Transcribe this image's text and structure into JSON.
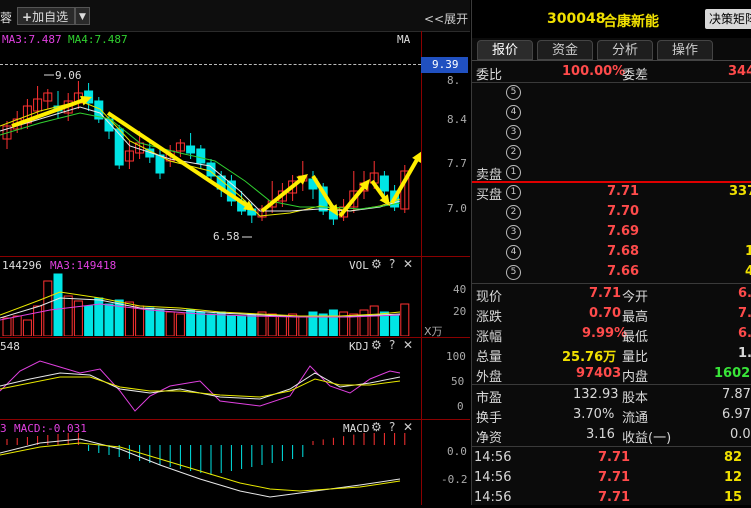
{
  "toolbar": {
    "name_fragment": "蓉",
    "add_favorite": "加自选",
    "expand": "<<展开"
  },
  "main_chart": {
    "ma3_label": "MA3:7.487",
    "ma4_label": "MA4:7.487",
    "ma_tag": "MA",
    "price_tag": "9.39",
    "y_ticks": [
      "8.4",
      "7.7",
      "7.0"
    ],
    "y_tick_top": "8.",
    "high_annot": "9.06",
    "low_annot": "6.58"
  },
  "vol_chart": {
    "vol_value": "144296",
    "ma3_value": "MA3:149418",
    "title": "VOL",
    "y_ticks": [
      "40",
      "20"
    ],
    "unit": "X万"
  },
  "kdj_chart": {
    "left_value": "548",
    "title": "KDJ",
    "y_ticks": [
      "100",
      "50",
      "0"
    ]
  },
  "macd_chart": {
    "left_value": "3",
    "macd_value": "MACD:-0.031",
    "title": "MACD",
    "y_ticks": [
      "0.0",
      "-0.2"
    ]
  },
  "quote": {
    "code": "300048",
    "name": "合康新能",
    "strategy_btn": "决策矩阵",
    "tabs": [
      "报价",
      "资金",
      "分析",
      "操作"
    ],
    "weibi_label": "委比",
    "weibi_value": "100.00%",
    "weicha_label": "委差",
    "weicha_value": "344",
    "sell_label": "卖盘",
    "sell_rows": [
      "5",
      "4",
      "3",
      "2",
      "1"
    ],
    "buy_label": "买盘",
    "buy_rows": [
      {
        "idx": "1",
        "price": "7.71",
        "vol": "337"
      },
      {
        "idx": "2",
        "price": "7.70",
        "vol": ""
      },
      {
        "idx": "3",
        "price": "7.69",
        "vol": ""
      },
      {
        "idx": "4",
        "price": "7.68",
        "vol": "1"
      },
      {
        "idx": "5",
        "price": "7.66",
        "vol": "4"
      }
    ],
    "stats": [
      {
        "l1": "现价",
        "v1": "7.71",
        "l2": "今开",
        "v2": "6."
      },
      {
        "l1": "涨跌",
        "v1": "0.70",
        "l2": "最高",
        "v2": "7."
      },
      {
        "l1": "涨幅",
        "v1": "9.99%",
        "l2": "最低",
        "v2": "6."
      },
      {
        "l1": "总量",
        "v1": "25.76万",
        "l2": "量比",
        "v2": "1."
      },
      {
        "l1": "外盘",
        "v1": "97403",
        "l2": "内盘",
        "v2": "1602"
      }
    ],
    "stats2": [
      {
        "l1": "市盈",
        "v1": "132.93",
        "l2": "股本",
        "v2": "7.87"
      },
      {
        "l1": "换手",
        "v1": "3.70%",
        "l2": "流通",
        "v2": "6.97"
      },
      {
        "l1": "净资",
        "v1": "3.16",
        "l2": "收益(一)",
        "v2": "0.0"
      }
    ],
    "ticks": [
      {
        "time": "14:56",
        "price": "7.71",
        "vol": "82"
      },
      {
        "time": "14:56",
        "price": "7.71",
        "vol": "12"
      },
      {
        "time": "14:56",
        "price": "7.71",
        "vol": "15"
      }
    ]
  },
  "colors": {
    "up": "#ff3232",
    "down": "#00e5e5",
    "ma_white": "#e8e8e8",
    "ma_yellow": "#e8e800",
    "ma_green": "#30d030",
    "ma_magenta": "#e040e0",
    "arrow": "#ffee00"
  }
}
